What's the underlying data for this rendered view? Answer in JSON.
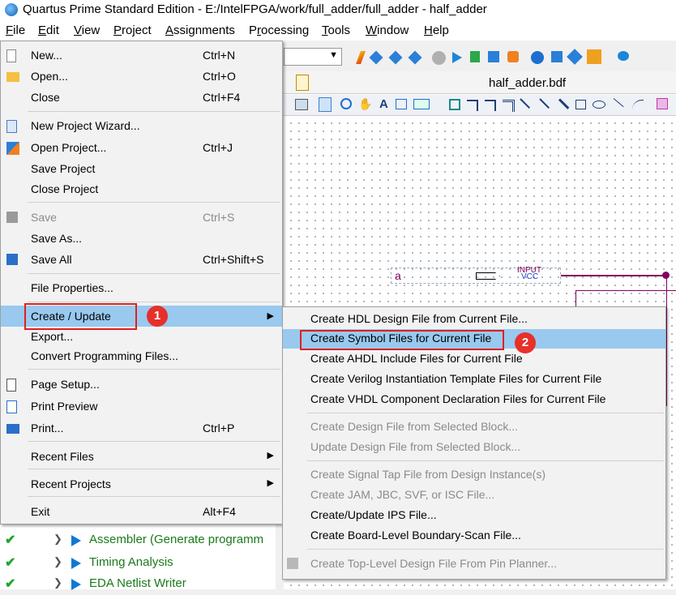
{
  "window": {
    "title": "Quartus Prime Standard Edition - E:/IntelFPGA/work/full_adder/full_adder - half_adder"
  },
  "menubar": [
    "File",
    "Edit",
    "View",
    "Project",
    "Assignments",
    "Processing",
    "Tools",
    "Window",
    "Help"
  ],
  "document": {
    "tab_title": "half_adder.bdf",
    "pin_name": "a",
    "pin_type": "INPUT",
    "pin_default": "VCC"
  },
  "file_menu": {
    "new": {
      "label": "New...",
      "shortcut": "Ctrl+N"
    },
    "open": {
      "label": "Open...",
      "shortcut": "Ctrl+O"
    },
    "close": {
      "label": "Close",
      "shortcut": "Ctrl+F4"
    },
    "new_project_wizard": {
      "label": "New Project Wizard..."
    },
    "open_project": {
      "label": "Open Project...",
      "shortcut": "Ctrl+J"
    },
    "save_project": {
      "label": "Save Project"
    },
    "close_project": {
      "label": "Close Project"
    },
    "save": {
      "label": "Save",
      "shortcut": "Ctrl+S"
    },
    "save_as": {
      "label": "Save As..."
    },
    "save_all": {
      "label": "Save All",
      "shortcut": "Ctrl+Shift+S"
    },
    "file_properties": {
      "label": "File Properties..."
    },
    "create_update": {
      "label": "Create / Update"
    },
    "export": {
      "label": "Export..."
    },
    "convert_programming": {
      "label": "Convert Programming Files..."
    },
    "page_setup": {
      "label": "Page Setup..."
    },
    "print_preview": {
      "label": "Print Preview"
    },
    "print": {
      "label": "Print...",
      "shortcut": "Ctrl+P"
    },
    "recent_files": {
      "label": "Recent Files"
    },
    "recent_projects": {
      "label": "Recent Projects"
    },
    "exit": {
      "label": "Exit",
      "shortcut": "Alt+F4"
    }
  },
  "submenu": [
    {
      "label": "Create HDL Design File from Current File...",
      "enabled": true
    },
    {
      "label": "Create Symbol Files for Current File",
      "enabled": true,
      "highlighted": true
    },
    {
      "label": "Create AHDL Include Files for Current File",
      "enabled": true
    },
    {
      "label": "Create Verilog Instantiation Template Files for Current File",
      "enabled": true
    },
    {
      "label": "Create VHDL Component Declaration Files for Current File",
      "enabled": true
    },
    {
      "label": "Create Design File from Selected Block...",
      "enabled": false
    },
    {
      "label": "Update Design File from Selected Block...",
      "enabled": false
    },
    {
      "label": "Create Signal Tap File from Design Instance(s)",
      "enabled": false
    },
    {
      "label": "Create JAM, JBC, SVF, or ISC File...",
      "enabled": false
    },
    {
      "label": "Create/Update IPS File...",
      "enabled": true
    },
    {
      "label": "Create Board-Level Boundary-Scan File...",
      "enabled": true
    },
    {
      "label": "Create Top-Level Design File From Pin Planner...",
      "enabled": false
    }
  ],
  "tasks": [
    {
      "label": "Assembler (Generate programm"
    },
    {
      "label": "Timing Analysis"
    },
    {
      "label": "EDA Netlist Writer"
    }
  ],
  "annotations": {
    "badge1": "1",
    "badge2": "2"
  },
  "colors": {
    "highlight": "#99c9ef",
    "annotation_red": "#e0201c",
    "task_green": "#1a7a1a",
    "wire": "#800060"
  }
}
